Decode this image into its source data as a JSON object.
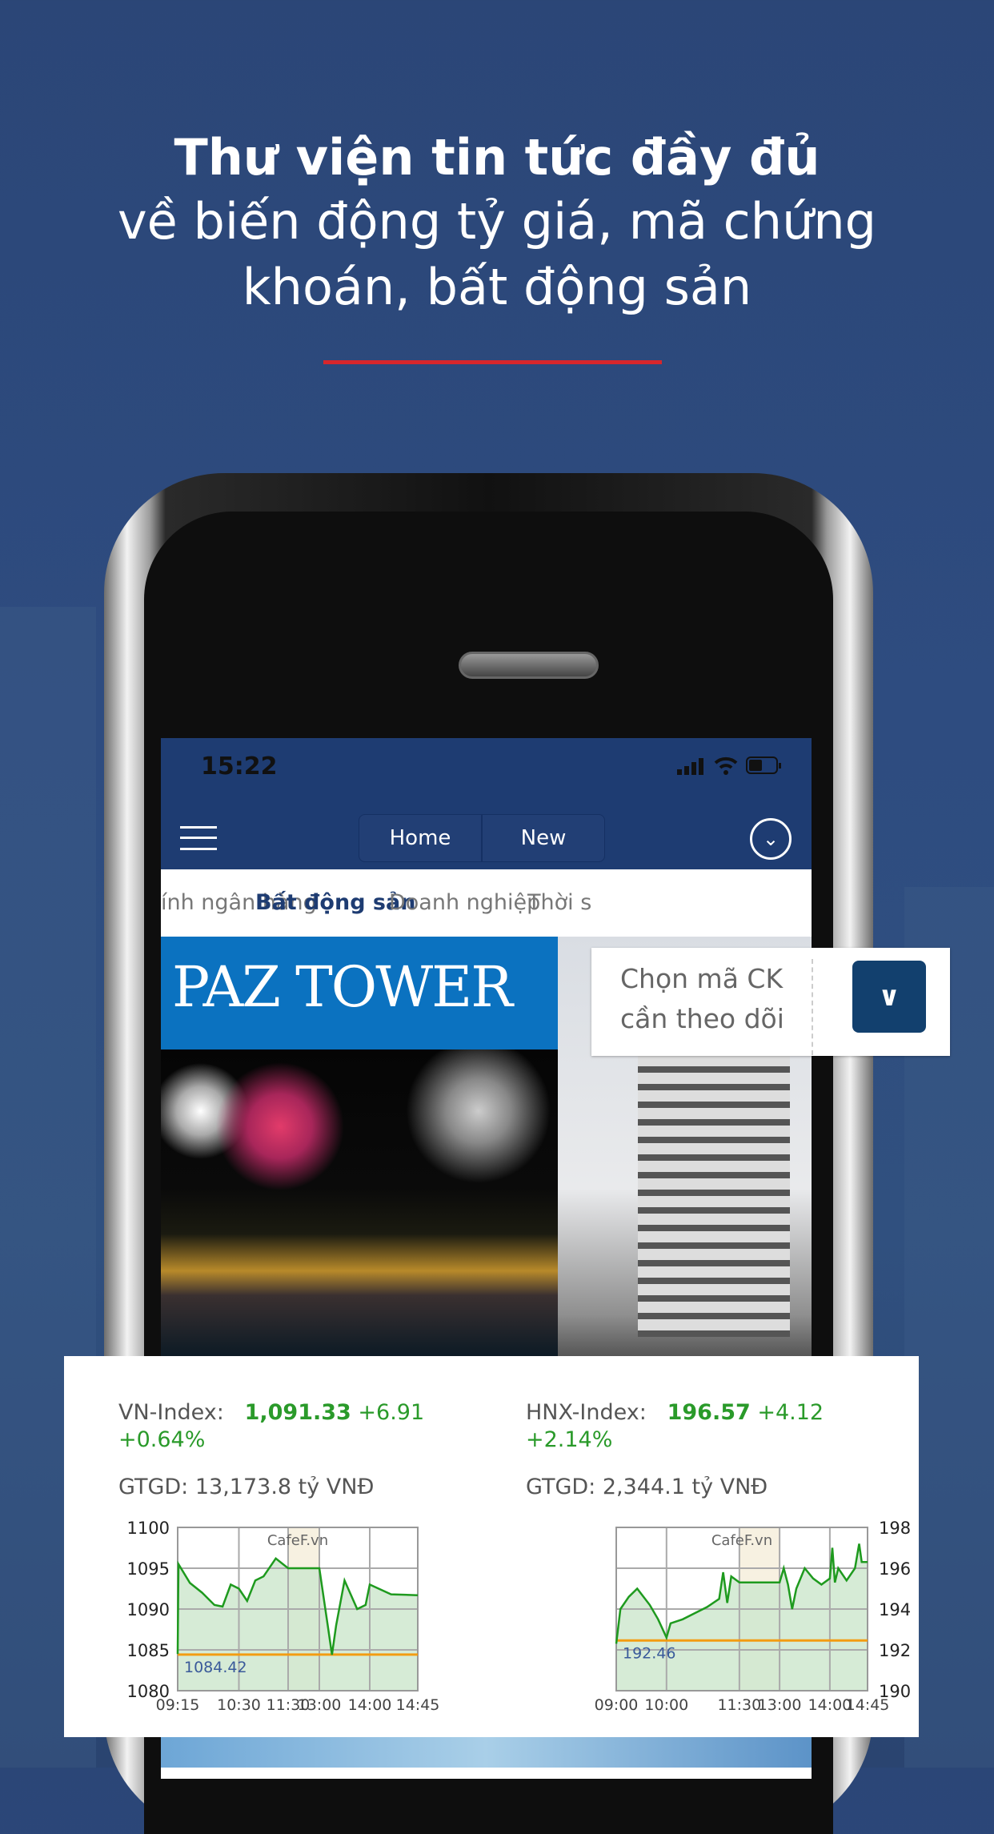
{
  "headline": {
    "line1": "Thư viện tin tức đầy đủ",
    "line2": "về biến động tỷ giá, mã chứng",
    "line3": "khoán, bất động sản",
    "accent": "#d7262b"
  },
  "status_bar": {
    "time": "15:22",
    "icons": [
      "signal-icon",
      "wifi-icon",
      "battery-icon"
    ]
  },
  "navbar": {
    "menu_icon": "hamburger-icon",
    "segments": [
      "Home",
      "New"
    ],
    "expand_icon": "chevron-down-circle-icon",
    "color": "#1e3c72"
  },
  "tabs": [
    {
      "label": "ính ngân hàng",
      "active": false
    },
    {
      "label": "Bất động sản",
      "active": true
    },
    {
      "label": "Doanh nghiệp",
      "active": false
    },
    {
      "label": "Thời s",
      "active": false
    }
  ],
  "hero": {
    "banner_text": "PAZ TOWER"
  },
  "stock_picker": {
    "placeholder_line1": "Chọn mã CK",
    "placeholder_line2": "cần theo dõi",
    "button_icon": "chevron-down-icon"
  },
  "indices": [
    {
      "name": "VN-Index:",
      "value": "1,091.33",
      "change": "+6.91",
      "percent": "+0.64%",
      "gtgd": "GTGD: 13,173.8 tỷ VNĐ"
    },
    {
      "name": "HNX-Index:",
      "value": "196.57",
      "change": "+4.12",
      "percent": "+2.14%",
      "gtgd": "GTGD: 2,344.1 tỷ VNĐ"
    }
  ],
  "chart_data": [
    {
      "type": "area",
      "watermark": "CafeF.vn",
      "ylim": [
        1080,
        1100
      ],
      "yticks": [
        "1100",
        "1095",
        "1090",
        "1085",
        "1080"
      ],
      "xticks": [
        "09:15",
        "10:30",
        "11:30",
        "13:00",
        "14:00",
        "14:45"
      ],
      "yaxis_side": "left",
      "grid": true,
      "shaded_break": [
        "11:30",
        "13:00"
      ],
      "reference": {
        "value": 1084.42,
        "label": "1084.42",
        "color": "#f39c12"
      },
      "line_color": "#1e9a1e",
      "fill_color": "#cfe8cf",
      "points": [
        [
          "09:15",
          1084.5
        ],
        [
          "09:16",
          1095.5
        ],
        [
          "09:30",
          1093.2
        ],
        [
          "09:45",
          1092
        ],
        [
          "10:00",
          1090.5
        ],
        [
          "10:10",
          1090.3
        ],
        [
          "10:20",
          1093
        ],
        [
          "10:30",
          1092.5
        ],
        [
          "10:40",
          1091
        ],
        [
          "10:50",
          1093.5
        ],
        [
          "11:00",
          1094
        ],
        [
          "11:15",
          1096.2
        ],
        [
          "11:30",
          1095
        ],
        [
          "13:00",
          1095
        ],
        [
          "13:10",
          1088
        ],
        [
          "13:15",
          1084.4
        ],
        [
          "13:20",
          1088
        ],
        [
          "13:30",
          1093.5
        ],
        [
          "13:45",
          1090
        ],
        [
          "13:55",
          1090.5
        ],
        [
          "14:00",
          1093
        ],
        [
          "14:10",
          1092.4
        ],
        [
          "14:20",
          1091.8
        ],
        [
          "14:45",
          1091.7
        ]
      ]
    },
    {
      "type": "area",
      "watermark": "CafeF.vn",
      "ylim": [
        190,
        198
      ],
      "yticks": [
        "198",
        "196",
        "194",
        "192",
        "190"
      ],
      "xticks": [
        "09:00",
        "10:00",
        "11:30",
        "13:00",
        "14:00",
        "14:45"
      ],
      "yaxis_side": "right",
      "grid": true,
      "shaded_break": [
        "11:30",
        "13:00"
      ],
      "reference": {
        "value": 192.46,
        "label": "192.46",
        "color": "#f39c12"
      },
      "line_color": "#1e9a1e",
      "fill_color": "#cfe8cf",
      "points": [
        [
          "09:00",
          192.3
        ],
        [
          "09:05",
          194
        ],
        [
          "09:15",
          194.6
        ],
        [
          "09:25",
          195
        ],
        [
          "09:40",
          194.2
        ],
        [
          "09:50",
          193.5
        ],
        [
          "10:00",
          192.6
        ],
        [
          "10:05",
          193.3
        ],
        [
          "10:20",
          193.5
        ],
        [
          "10:35",
          193.8
        ],
        [
          "10:50",
          194.1
        ],
        [
          "11:05",
          194.5
        ],
        [
          "11:10",
          195.8
        ],
        [
          "11:15",
          194.3
        ],
        [
          "11:20",
          195.6
        ],
        [
          "11:30",
          195.3
        ],
        [
          "13:00",
          195.3
        ],
        [
          "13:05",
          196
        ],
        [
          "13:10",
          195.2
        ],
        [
          "13:15",
          194
        ],
        [
          "13:20",
          195
        ],
        [
          "13:30",
          196
        ],
        [
          "13:40",
          195.5
        ],
        [
          "13:50",
          195.2
        ],
        [
          "14:00",
          195.5
        ],
        [
          "14:03",
          197
        ],
        [
          "14:06",
          195.3
        ],
        [
          "14:10",
          196
        ],
        [
          "14:20",
          195.4
        ],
        [
          "14:30",
          196
        ],
        [
          "14:35",
          197.2
        ],
        [
          "14:38",
          196.3
        ],
        [
          "14:45",
          196.3
        ]
      ]
    }
  ]
}
